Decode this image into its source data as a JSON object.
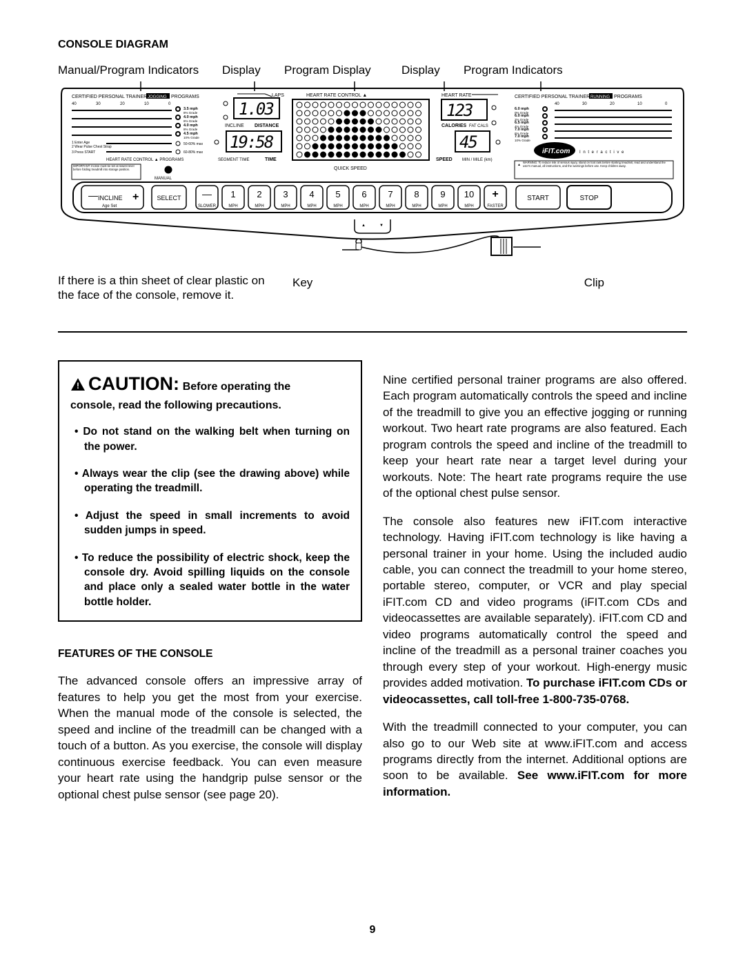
{
  "header": {
    "title": "CONSOLE DIAGRAM"
  },
  "diagram_labels": {
    "manual_program": "Manual/Program Indicators",
    "display1": "Display",
    "program_display": "Program Display",
    "display2": "Display",
    "program_indicators": "Program Indicators",
    "note_left": "If there is a thin sheet of clear plastic on the face of the console, remove it.",
    "key": "Key",
    "clip": "Clip"
  },
  "console": {
    "jogging_title_left": "CERTIFIED PERSONAL TRAINER",
    "jogging_badge": "JOGGING",
    "programs_suffix": "PROGRAMS",
    "running_title_left": "CERTIFIED PERSONAL TRAINER",
    "running_badge": "RUNNING",
    "scale_left": {
      "v40": "40",
      "v30": "30",
      "v20": "20",
      "v10": "10",
      "v0": "0"
    },
    "scale_right": {
      "v40": "40",
      "v30": "30",
      "v20": "20",
      "v10": "10",
      "v0": "0"
    },
    "jog_speeds": [
      {
        "mph": "3.5 mph",
        "grade": "8% Grade"
      },
      {
        "mph": "4.0 mph",
        "grade": "6% Grade"
      },
      {
        "mph": "4.0 mph",
        "grade": "8% Grade"
      },
      {
        "mph": "4.5 mph",
        "grade": "10% Grade"
      }
    ],
    "run_speeds": [
      {
        "mph": "6.0 mph",
        "grade": "0% Grade"
      },
      {
        "mph": "6.0 mph",
        "grade": "2% Grade"
      },
      {
        "mph": "6.5 mph",
        "grade": "4% Grade"
      },
      {
        "mph": "7.0 mph",
        "grade": "6% Grade"
      },
      {
        "mph": "7.0 mph",
        "grade": "10% Grade"
      }
    ],
    "hrc_left_steps": [
      "1  Enter Age",
      "2  Wear Pulse Chest Strap",
      "3  Press START"
    ],
    "hrc_left_levels": [
      "50-60% max",
      "60-80% max"
    ],
    "hrc_heading": "HEART RATE CONTROL ▲ PROGRAMS",
    "important": "IMPORTANT: Incline must be set at lowest level before folding treadmill into storage position.",
    "manual_label": "MANUAL",
    "laps": "LAPS",
    "disp_top": "1.03",
    "incline_word": "INCLINE",
    "distance_word": "DISTANCE",
    "disp_bottom": "19:58",
    "segment_time": "SEGMENT TIME",
    "time_word": "TIME",
    "hr_control_title": "HEART RATE CONTROL ▲",
    "quick_speed": "QUICK SPEED",
    "heart_rate_title": "HEART RATE",
    "disp_hr": "123",
    "disp_cal": "45",
    "calories": "CALORIES",
    "fatcals": "FAT CALS",
    "speed_word": "SPEED",
    "minmile": "MIN / MILE (km)",
    "ifit": "iFIT.com",
    "interactive": "I n t e r a c t i v e",
    "warning": "WARNING: To reduce risk of serious injury, stand on foot rails before starting treadmill, read and understand the user's manual, all instructions, and the warnings before use. Keep children away.",
    "incline_btn": "INCLINE",
    "age_set": "Age Set",
    "select_btn": "SELECT",
    "slower": "SLOWER",
    "faster": "FASTER",
    "mph": "MPH",
    "start": "START",
    "stop": "STOP",
    "speed_nums": [
      "1",
      "2",
      "3",
      "4",
      "5",
      "6",
      "7",
      "8",
      "9",
      "10"
    ],
    "tri_up": "▲",
    "tri_dn": "▼"
  },
  "caution": {
    "word": "CAUTION:",
    "lead": "Before operating the",
    "line2": "console, read the following precautions.",
    "items": [
      "Do not stand on the walking belt when turning on the power.",
      "Always wear the clip (see the drawing above) while operating the treadmill.",
      "Adjust the speed in small increments to avoid sudden jumps in speed.",
      "To reduce the possibility of electric shock, keep the console dry. Avoid spilling liquids on the console and place only a sealed water bottle in the water bottle holder."
    ]
  },
  "features": {
    "title": "FEATURES OF THE CONSOLE",
    "p1": "The advanced console offers an impressive array of features to help you get the most from your exercise. When the manual mode of the console is selected, the speed and incline of the treadmill can be changed with a touch of a button. As you exercise, the console will display continuous exercise feedback. You can even measure your heart rate using the handgrip pulse sensor or the optional chest pulse sensor (see page 20)."
  },
  "right_col": {
    "p1": "Nine certified personal trainer programs are also offered. Each program automatically controls the speed and incline of the treadmill to give you an effective jogging or running workout. Two heart rate programs are also featured. Each program controls the speed and incline of the treadmill to keep your heart rate near a target level during your workouts. Note: The heart rate programs require the use of the optional chest pulse sensor.",
    "p2a": "The console also features new iFIT.com interactive technology. Having iFIT.com technology is like having a personal trainer in your home. Using the included audio cable, you can connect the treadmill to your home stereo, portable stereo, computer, or VCR and play special iFIT.com CD and video programs (iFIT.com CDs and videocassettes are available separately). iFIT.com CD and video programs automatically control the speed and incline of the treadmill as a personal trainer coaches you through every step of your workout. High-energy music provides added motivation. ",
    "p2b": "To purchase iFIT.com CDs or videocassettes, call toll-free 1-800-735-0768.",
    "p3a": "With the treadmill connected to your computer, you can also go to our Web site at www.iFIT.com and access programs directly from the internet. Additional options are soon to be available. ",
    "p3b": "See www.iFIT.com for more information."
  },
  "page_number": "9"
}
